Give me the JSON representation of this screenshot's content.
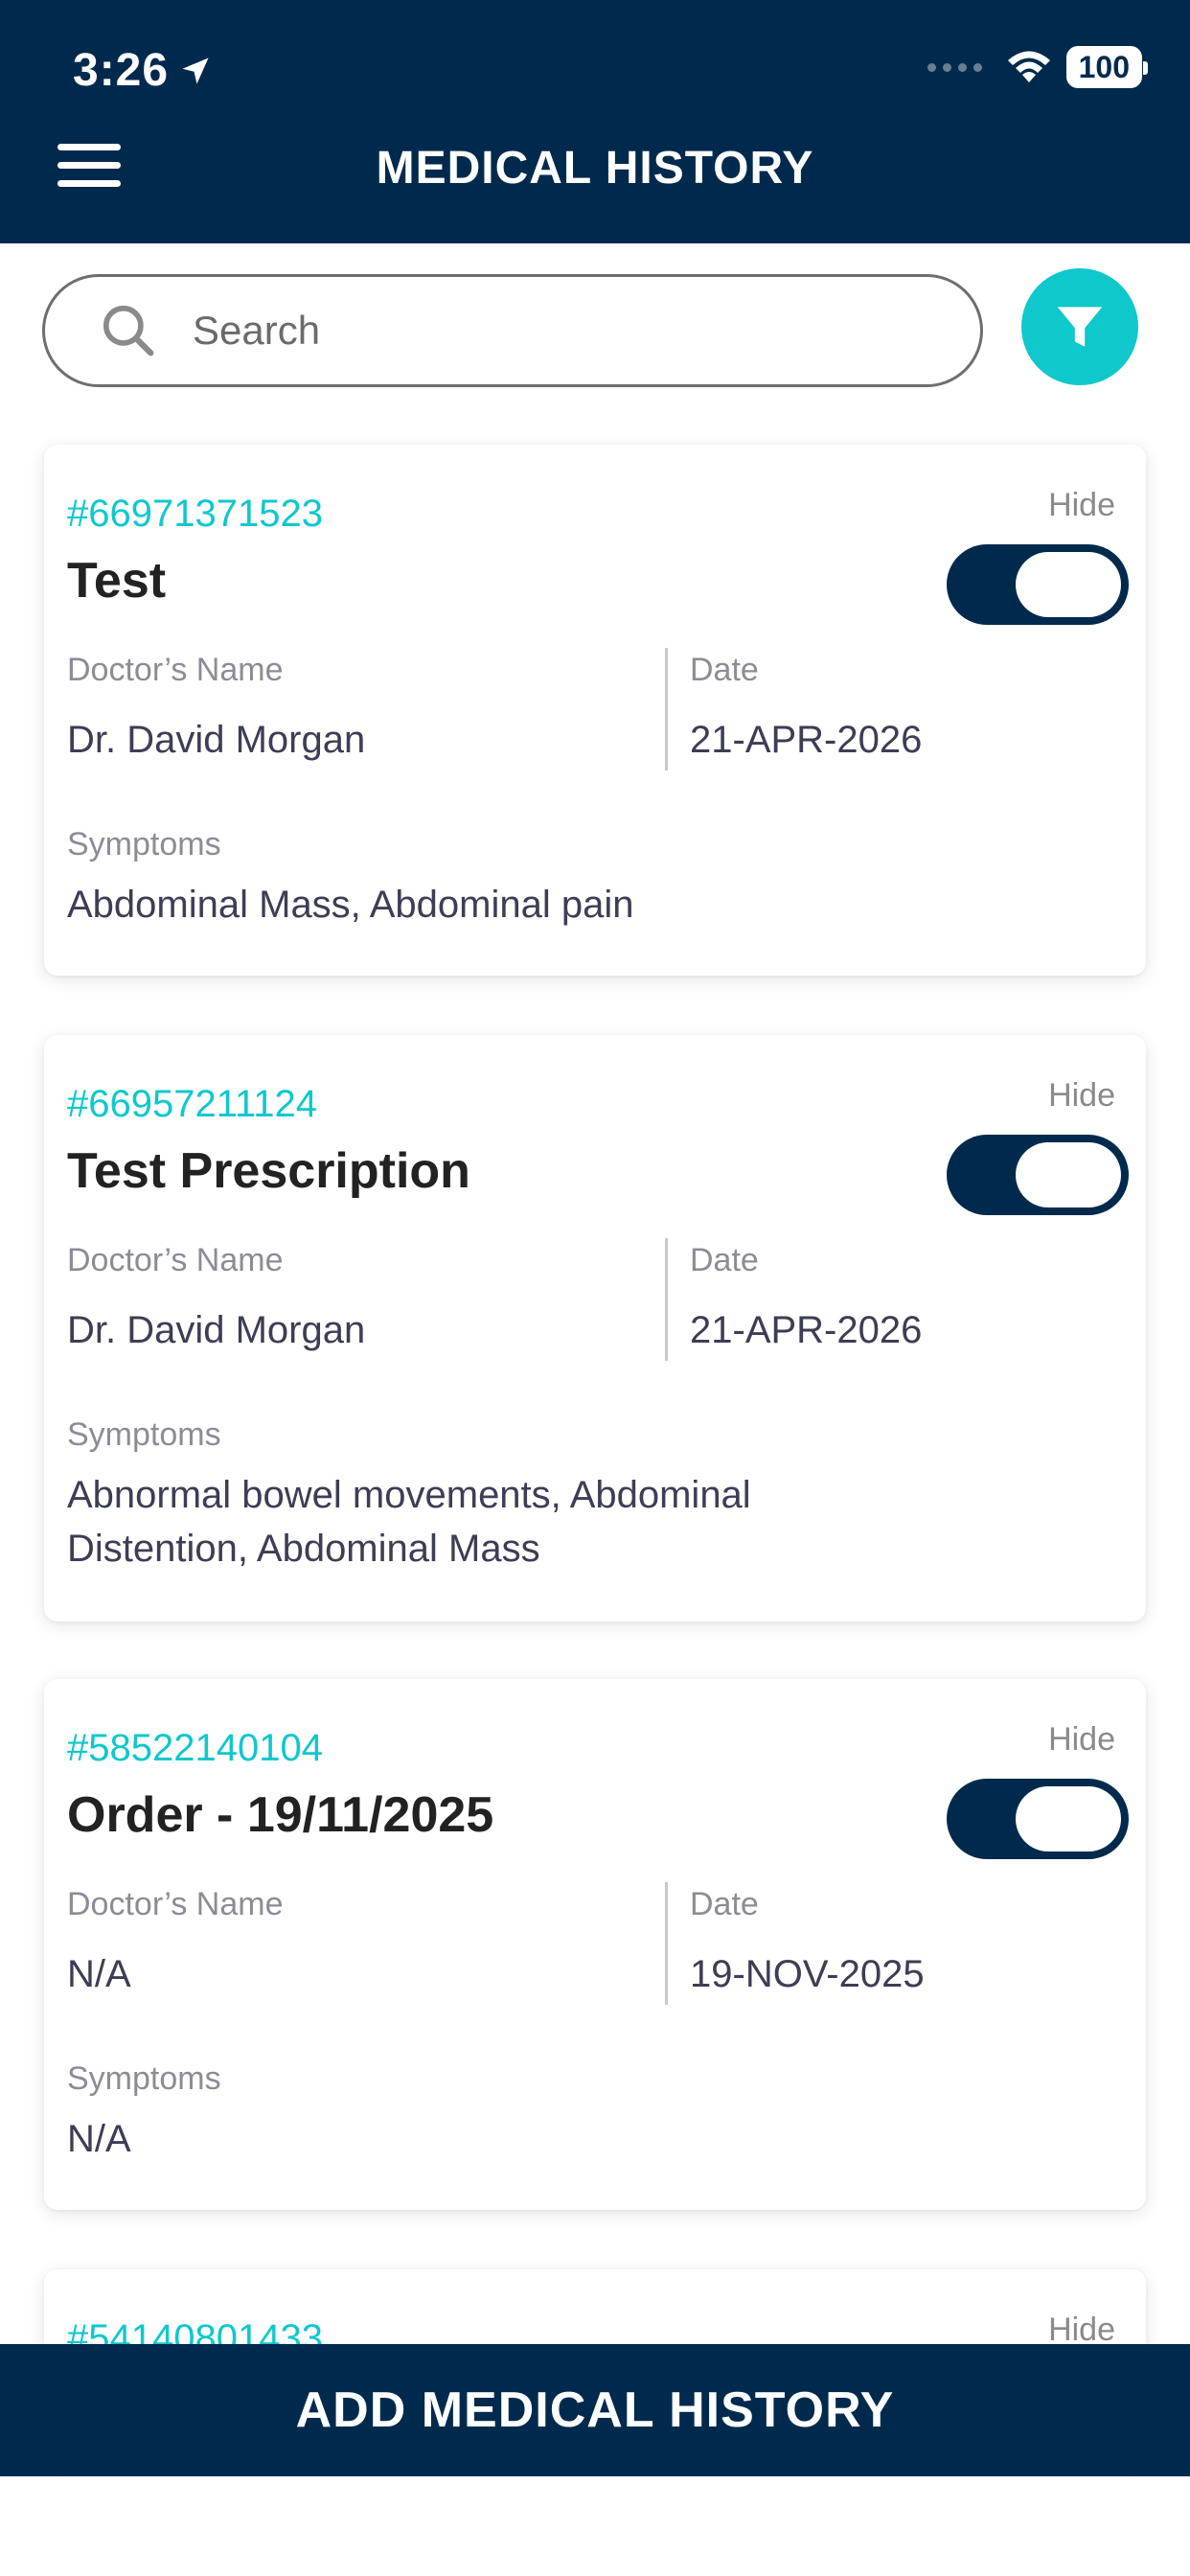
{
  "status_bar": {
    "time": "3:26",
    "battery": "100"
  },
  "header": {
    "title": "MEDICAL HISTORY"
  },
  "search": {
    "placeholder": "Search"
  },
  "labels": {
    "hide": "Hide",
    "doctor": "Doctor’s Name",
    "date": "Date",
    "symptoms": "Symptoms"
  },
  "records": [
    {
      "id": "#66971371523",
      "title": "Test",
      "doctor": "Dr. David Morgan",
      "date": "21-APR-2026",
      "symptoms": "Abdominal Mass, Abdominal pain"
    },
    {
      "id": "#66957211124",
      "title": "Test Prescription",
      "doctor": "Dr. David Morgan",
      "date": "21-APR-2026",
      "symptoms": "Abnormal bowel movements, Abdominal Distention, Abdominal Mass"
    },
    {
      "id": "#58522140104",
      "title": "Order - 19/11/2025",
      "doctor": "N/A",
      "date": "19-NOV-2025",
      "symptoms": "N/A"
    },
    {
      "id": "#54140801433"
    }
  ],
  "footer": {
    "add_button": "ADD MEDICAL HISTORY"
  },
  "colors": {
    "navy": "#002a4d",
    "teal": "#0ec8cc"
  }
}
